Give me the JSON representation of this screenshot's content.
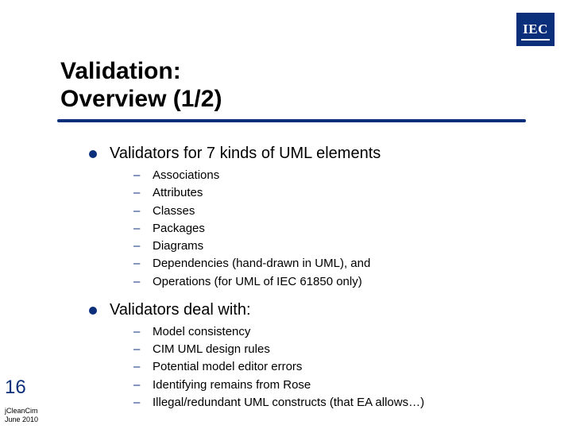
{
  "logo": {
    "text": "IEC"
  },
  "title": {
    "line1": "Validation:",
    "line2": "Overview (1/2)"
  },
  "content": {
    "p1": {
      "heading": "Validators for 7 kinds of UML elements",
      "items": [
        "Associations",
        "Attributes",
        "Classes",
        "Packages",
        "Diagrams",
        "Dependencies (hand-drawn in UML), and",
        "Operations (for UML of IEC 61850 only)"
      ]
    },
    "p2": {
      "heading": "Validators deal with:",
      "items": [
        "Model consistency",
        "CIM UML design rules",
        "Potential model editor errors",
        "Identifying remains from Rose",
        "Illegal/redundant UML constructs (that EA allows…)"
      ]
    }
  },
  "page_number": "16",
  "footer": {
    "line1": "jCleanCim",
    "line2": "June 2010"
  }
}
